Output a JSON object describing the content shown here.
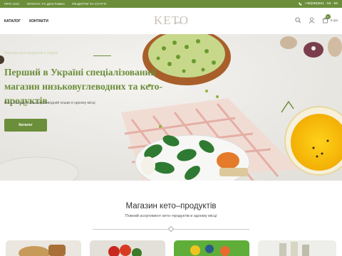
{
  "topbar": {
    "links": [
      "ПРО НАС",
      "ОПЛАТА ТА ДОСТАВКА",
      "РЕЦЕПТИ ТА СТАТТІ"
    ],
    "phone": "+38(068)561 - 55 - 55"
  },
  "header": {
    "nav": [
      "КАТАЛОГ",
      "КОНТАКТИ"
    ],
    "logo": "KETO",
    "logo_sub": "shop",
    "cart_count": "0",
    "cart_total": "0 грн"
  },
  "hero": {
    "kicker": "Магазин кето-продуктів в Україні",
    "title_line1": "Перший в Україні спеціалізований",
    "title_line2": "магазин низьковуглеводних та кето-продуктів",
    "subtitle": "Весь базовий низьковуглеводний кошик в одному місці",
    "button": "Каталог"
  },
  "section": {
    "title": "Магазин кето–продуктів",
    "subtitle": "Повний асортимент кето–продуктів в одному місці"
  },
  "colors": {
    "brand_green": "#6b8e3a",
    "logo_gray": "#c9c2b7"
  }
}
